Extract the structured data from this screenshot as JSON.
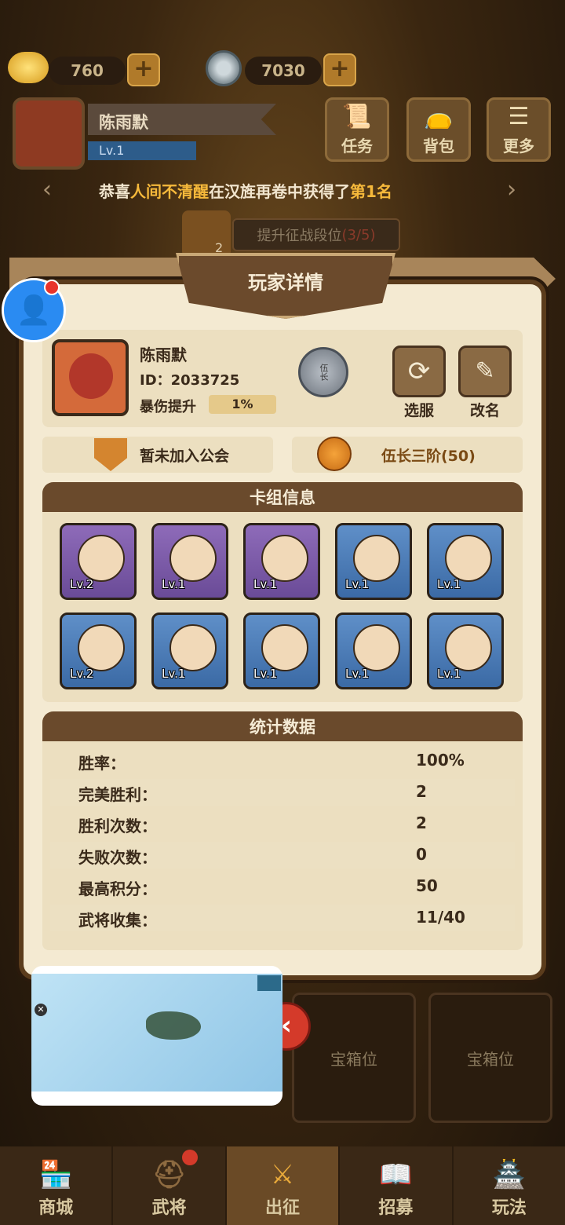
{
  "currency": {
    "gold": "760",
    "coins": "7030",
    "plus": "+"
  },
  "player_bar": {
    "name": "陈雨默",
    "level": "Lv.1"
  },
  "top_buttons": [
    {
      "label": "任务",
      "icon": "scroll-icon"
    },
    {
      "label": "背包",
      "icon": "bag-icon"
    },
    {
      "label": "更多",
      "icon": "menu-icon"
    }
  ],
  "announcement": {
    "pre": "恭喜",
    "name": "人间不清醒",
    "mid": "在汉旌再卷中获得了",
    "rank": "第1名"
  },
  "task_hint": {
    "badge": "2",
    "text": "提升征战段位",
    "progress": "(3/5)"
  },
  "dialog": {
    "title": "玩家详情",
    "name": "陈雨默",
    "id_text": "ID：2033725",
    "crit_label": "暴伤提升",
    "crit_value": "1%",
    "rank_badge": "伍长",
    "btn_server": "选服",
    "btn_rename": "改名",
    "guild": "暂未加入公会",
    "rank_title": "伍长三阶(50)",
    "deck_title": "卡组信息",
    "stats_title": "统计数据"
  },
  "deck": [
    {
      "lv": "Lv.2",
      "color": "purple"
    },
    {
      "lv": "Lv.1",
      "color": "purple"
    },
    {
      "lv": "Lv.1",
      "color": "purple"
    },
    {
      "lv": "Lv.1",
      "color": "blue"
    },
    {
      "lv": "Lv.1",
      "color": "blue"
    },
    {
      "lv": "Lv.2",
      "color": "blue"
    },
    {
      "lv": "Lv.1",
      "color": "blue"
    },
    {
      "lv": "Lv.1",
      "color": "blue"
    },
    {
      "lv": "Lv.1",
      "color": "blue"
    },
    {
      "lv": "Lv.1",
      "color": "blue"
    }
  ],
  "stats": [
    {
      "k": "胜率：",
      "v": "100%"
    },
    {
      "k": "完美胜利：",
      "v": "2"
    },
    {
      "k": "胜利次数：",
      "v": "2"
    },
    {
      "k": "失败次数：",
      "v": "0"
    },
    {
      "k": "最高积分：",
      "v": "50"
    },
    {
      "k": "武将收集：",
      "v": "11/40"
    }
  ],
  "chest_slots": [
    "宝箱位",
    "宝箱位"
  ],
  "tabs": [
    {
      "label": "商城",
      "icon": "shop-icon"
    },
    {
      "label": "武将",
      "icon": "general-icon"
    },
    {
      "label": "出征",
      "icon": "battle-icon"
    },
    {
      "label": "招募",
      "icon": "recruit-icon"
    },
    {
      "label": "玩法",
      "icon": "gameplay-icon"
    }
  ]
}
